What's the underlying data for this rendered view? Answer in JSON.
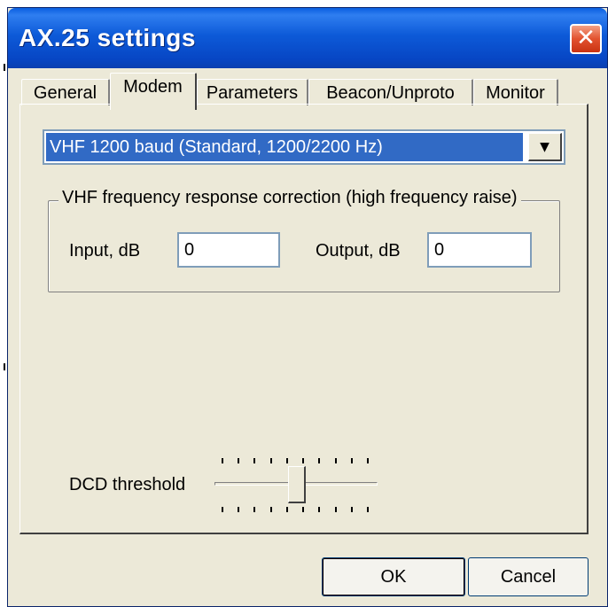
{
  "window": {
    "title": "AX.25 settings",
    "close_glyph": "✕"
  },
  "tabs": [
    {
      "label": "General",
      "active": false
    },
    {
      "label": "Modem",
      "active": true
    },
    {
      "label": "Parameters",
      "active": false
    },
    {
      "label": "Beacon/Unproto",
      "active": false
    },
    {
      "label": "Monitor",
      "active": false
    }
  ],
  "modem": {
    "selected_mode": "VHF 1200 baud  (Standard, 1200/2200 Hz)",
    "dropdown_arrow": "▼"
  },
  "correction": {
    "group_title": "VHF frequency response correction (high frequency raise)",
    "input_label": "Input, dB",
    "input_value": "0",
    "output_label": "Output, dB",
    "output_value": "0"
  },
  "dcd": {
    "label": "DCD threshold",
    "ticks": 10,
    "value_fraction": 0.45
  },
  "buttons": {
    "ok": "OK",
    "cancel": "Cancel"
  },
  "colors": {
    "titlebar": "#0a5fe0",
    "selection": "#316ac5",
    "dialog_bg": "#ece9d8",
    "close": "#e2522e"
  },
  "icons": {
    "close": "close-icon",
    "dropdown": "chevron-down-icon"
  }
}
